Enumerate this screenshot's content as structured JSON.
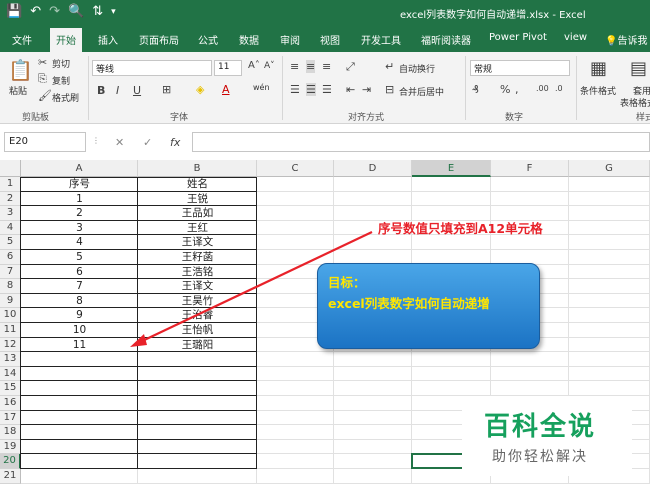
{
  "window": {
    "title": "excel列表数字如何自动递增.xlsx - Excel",
    "qat_icons": [
      "save-icon",
      "undo-icon",
      "redo-icon",
      "print-preview-icon",
      "sort-icon",
      "customize-qat-icon"
    ]
  },
  "tabs": [
    "文件",
    "开始",
    "插入",
    "页面布局",
    "公式",
    "数据",
    "审阅",
    "视图",
    "开发工具",
    "福昕阅读器",
    "Power Pivot",
    "view",
    "告诉我"
  ],
  "active_tab": "开始",
  "ribbon": {
    "paste": "粘贴",
    "cut": "剪切",
    "copy": "复制",
    "format_painter": "格式刷",
    "clipboard_group": "剪贴板",
    "font_name": "等线",
    "font_size": "11",
    "font_group": "字体",
    "wen": "wén",
    "alignment_group": "对齐方式",
    "wrap_text": "自动换行",
    "merge_center": "合并后居中",
    "number_format": "常规",
    "number_group": "数字",
    "cond_format": "条件格式",
    "table_format_1": "套用",
    "table_format_2": "表格格式",
    "styles_group": "样式"
  },
  "formula_bar": {
    "name_box": "E20",
    "fx": "fx",
    "value": ""
  },
  "grid": {
    "columns": [
      "A",
      "B",
      "C",
      "D",
      "E",
      "F",
      "G"
    ],
    "selected_column": "E",
    "rows": [
      "1",
      "2",
      "3",
      "4",
      "5",
      "6",
      "7",
      "8",
      "9",
      "10",
      "11",
      "12",
      "13",
      "14",
      "15",
      "16",
      "17",
      "18",
      "19",
      "20",
      "21"
    ],
    "selected_row": "20",
    "headers": {
      "a": "序号",
      "b": "姓名"
    },
    "data": [
      {
        "a": "1",
        "b": "王锐"
      },
      {
        "a": "2",
        "b": "王品如"
      },
      {
        "a": "3",
        "b": "王红"
      },
      {
        "a": "4",
        "b": "王译文"
      },
      {
        "a": "5",
        "b": "王籽菡"
      },
      {
        "a": "6",
        "b": "王浩铭"
      },
      {
        "a": "7",
        "b": "王译文"
      },
      {
        "a": "8",
        "b": "王昊竹"
      },
      {
        "a": "9",
        "b": "王治睿"
      },
      {
        "a": "10",
        "b": "王怡帆"
      },
      {
        "a": "11",
        "b": "王璐阳"
      }
    ]
  },
  "annotation": "序号数值只填充到A12单元格",
  "callout": {
    "title": "目标：",
    "body": "excel列表数字如何自动递增"
  },
  "watermark": {
    "line1": "百科全说",
    "line2": "助你轻松解决"
  },
  "colors": {
    "excel_green": "#217346",
    "annotation_red": "#e8222a",
    "callout_text": "#ffe600",
    "watermark_green": "#16a05d"
  }
}
